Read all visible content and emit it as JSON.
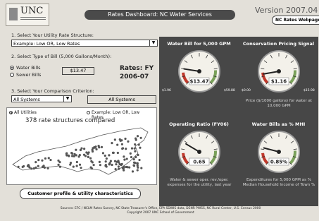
{
  "header": {
    "logo_text": "UNC",
    "title": "Rates Dashboard: NC Water Services",
    "version": "Version 2007.04",
    "webpage_button": "NC Rates Webpage"
  },
  "step1": {
    "label": "1. Select Your Utility Rate Structure:",
    "selected": "Example: Low OR, Low Rates"
  },
  "step2": {
    "label": "2. Select Type of Bill (5,000 Gallons/Month):",
    "water_bills": "Water Bills",
    "sewer_bills": "Sewer Bills",
    "bill_value": "$13.47",
    "rates_label": "Rates: FY",
    "rates_year": "2006-07"
  },
  "step3": {
    "label": "3. Select Your Comparison Criterion:",
    "selected": "All Systems",
    "display": "All Systems"
  },
  "map": {
    "legend_all": "All Utilities",
    "legend_example": "Example: Low OR, Low",
    "legend_example2": "Rates",
    "count_text": "378 rate structures compared"
  },
  "profile_button": "Customer profile & utility characteristics",
  "sources": {
    "line1": "Sources: EFC / NCLM Rates Survey, NC State Treasurer's Office, EPA SDWIS data, DENR PWSS, NC Rural Center, U.S. Census 2000",
    "line2": "Copyright 2007 UNC School of Government"
  },
  "gauges": [
    {
      "title": "Water Bill for 5,000 GPM",
      "value": "$13.47",
      "min": "$1.96",
      "max": "$59.88",
      "fraction": 0.2,
      "caption": ""
    },
    {
      "title": "Conservation Pricing Signal",
      "value": "$1.16",
      "min": "$0.00",
      "max": "$15.98",
      "fraction": 0.13,
      "caption": "Price ($/1000 gallons) for water at 10,000 GPM"
    },
    {
      "title": "Operating Ratio (FY06)",
      "value": "0.65",
      "min": "",
      "max": "",
      "fraction": 0.28,
      "caption": "Water & sewer oper. rev./oper. expenses for the utility, last year"
    },
    {
      "title": "Water Bills as % MHI",
      "value": "0.85%",
      "min": "",
      "max": "",
      "fraction": 0.22,
      "caption": "Expenditures for 5,000 GPM as % Median Household Income of Town %"
    }
  ],
  "colors": {
    "panel": "#474747",
    "gauge_red": "#c0392b",
    "gauge_green": "#7aa15a",
    "map_dot": "#555555"
  }
}
